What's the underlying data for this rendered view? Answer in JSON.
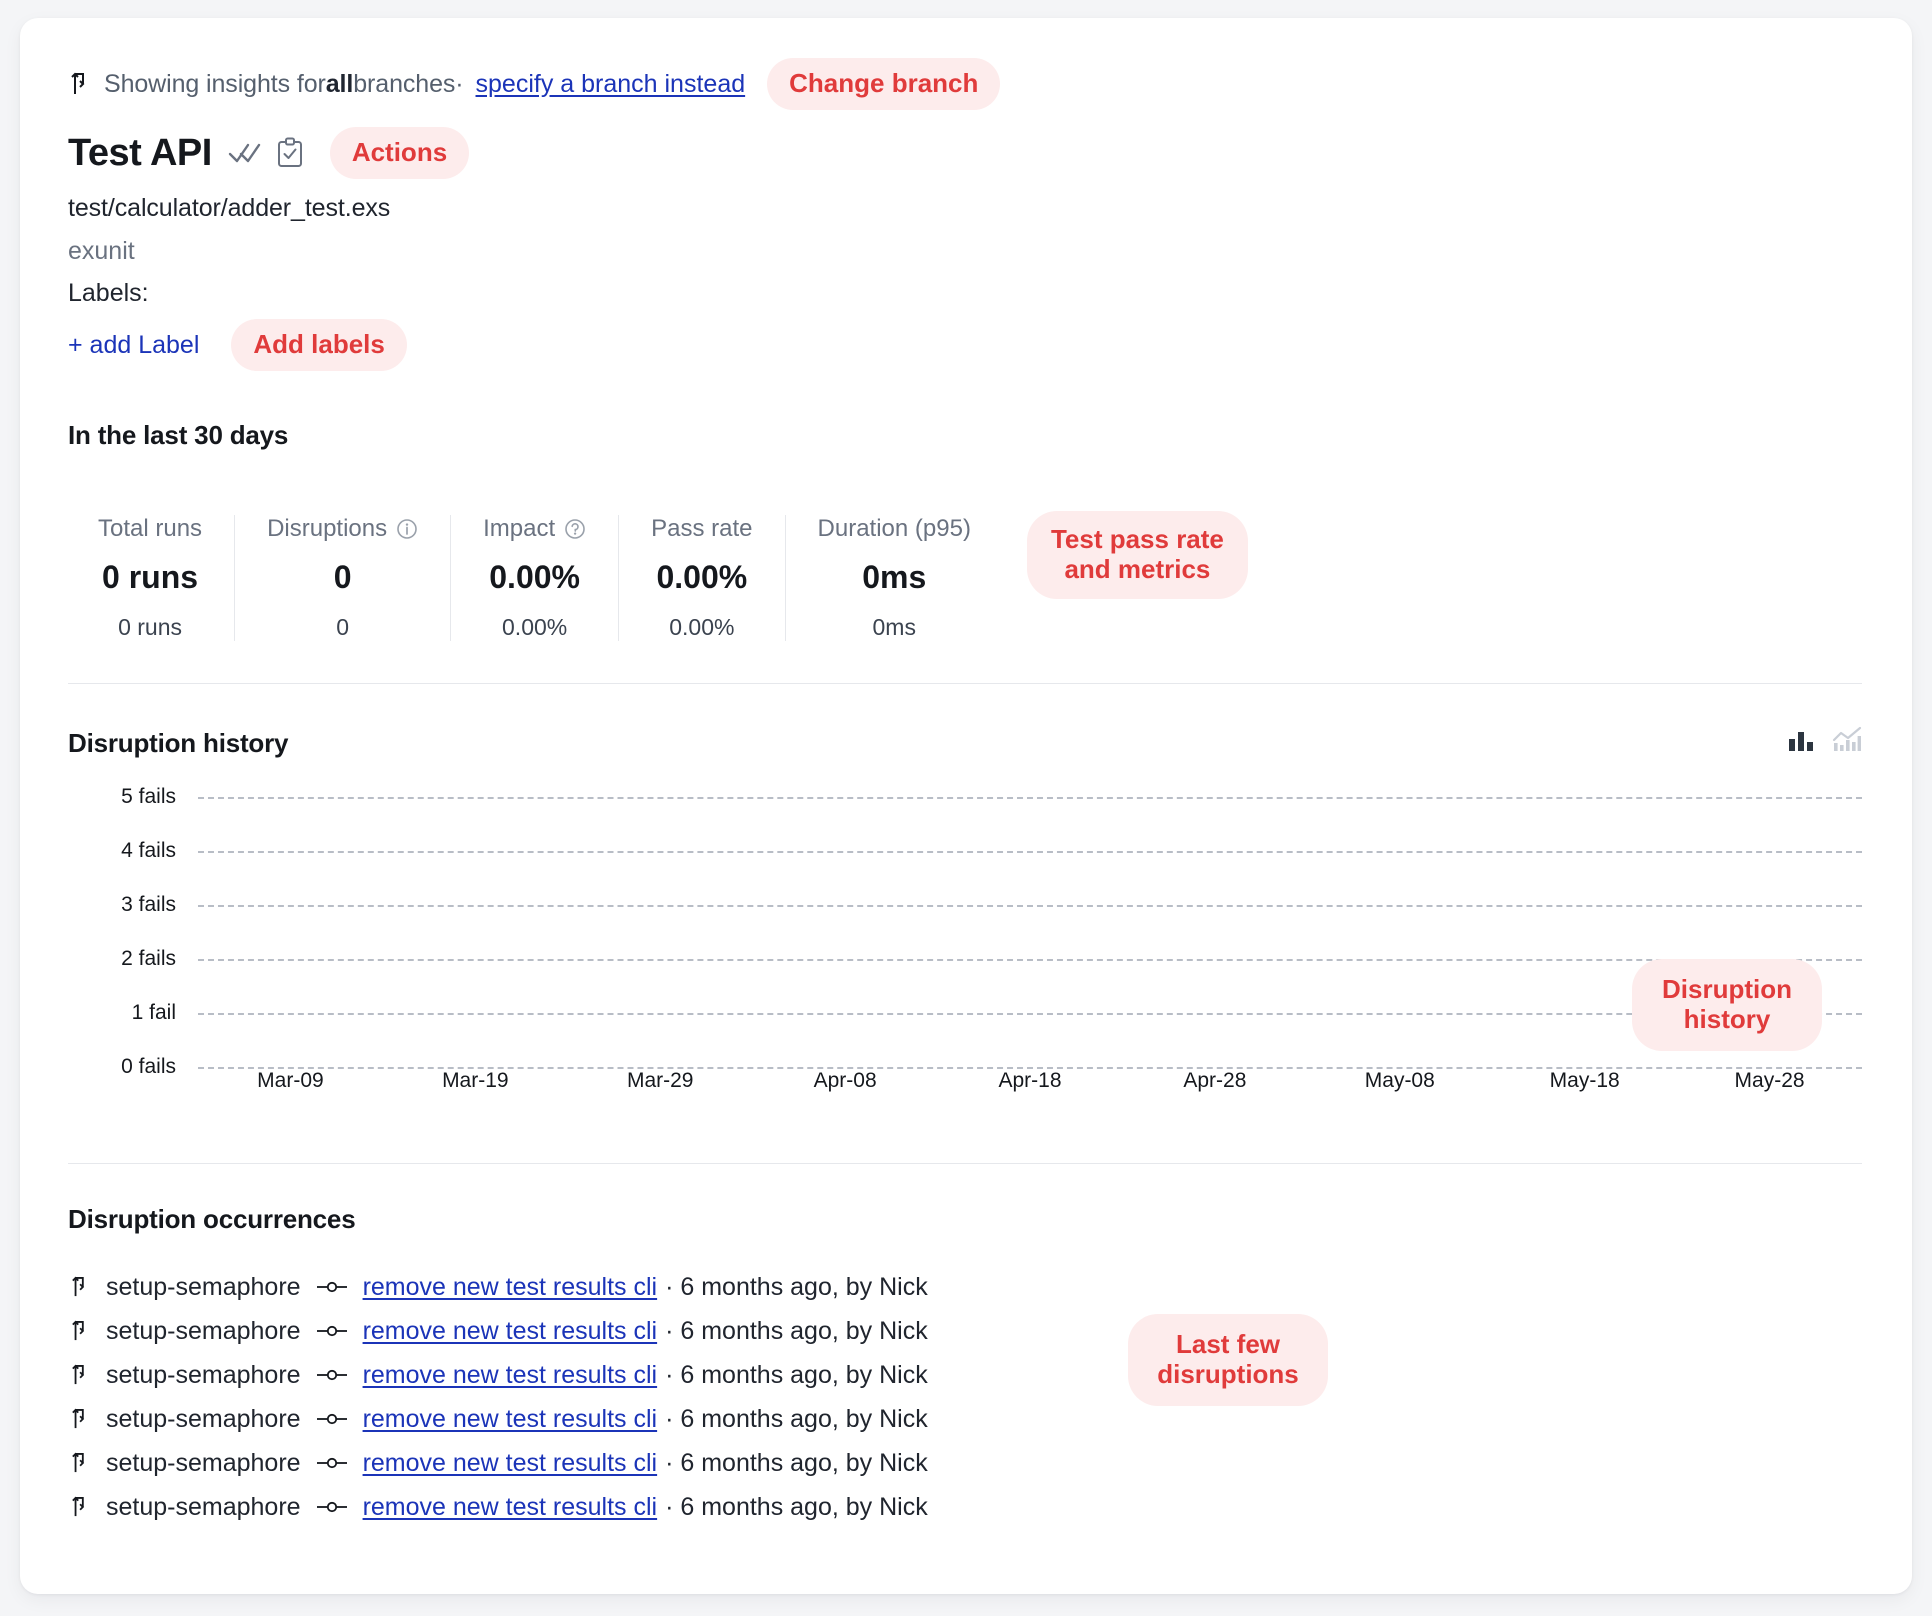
{
  "branch_notice": {
    "icon": "branch-icon",
    "prefix": "Showing insights for ",
    "bold": "all",
    "suffix": " branches·",
    "link": "specify a branch instead",
    "callout": "Change branch"
  },
  "test": {
    "title": "Test API",
    "icons": [
      "double-check-icon",
      "clipboard-check-icon"
    ],
    "actions_callout": "Actions",
    "path": "test/calculator/adder_test.exs",
    "framework": "exunit",
    "labels_heading": "Labels:",
    "add_label_link": "+ add Label",
    "add_labels_callout": "Add labels"
  },
  "metrics": {
    "heading": "In the last 30 days",
    "callout": "Test pass rate\nand metrics",
    "items": [
      {
        "label": "Total runs",
        "info": "",
        "value": "0 runs",
        "sub": "0 runs"
      },
      {
        "label": "Disruptions",
        "info": "ⓘ",
        "value": "0",
        "sub": "0"
      },
      {
        "label": "Impact",
        "info": "?",
        "value": "0.00%",
        "sub": "0.00%"
      },
      {
        "label": "Pass rate",
        "info": "",
        "value": "0.00%",
        "sub": "0.00%"
      },
      {
        "label": "Duration (p95)",
        "info": "",
        "value": "0ms",
        "sub": "0ms"
      }
    ]
  },
  "disruption_history": {
    "heading": "Disruption history",
    "callout": "Disruption\nhistory",
    "toggle": [
      {
        "icon": "bar-chart-icon",
        "active": true
      },
      {
        "icon": "line-chart-icon",
        "active": false
      }
    ]
  },
  "chart_data": {
    "type": "bar",
    "title": "Disruption history",
    "xlabel": "",
    "ylabel": "fails",
    "categories": [
      "Mar-09",
      "Mar-19",
      "Mar-29",
      "Apr-08",
      "Apr-18",
      "Apr-28",
      "May-08",
      "May-18",
      "May-28"
    ],
    "values": [
      0,
      0,
      0,
      0,
      0,
      0,
      0,
      0,
      0
    ],
    "ytick_labels": [
      "5 fails",
      "4 fails",
      "3 fails",
      "2 fails",
      "1 fail",
      "0 fails"
    ],
    "ytick_values": [
      5,
      4,
      3,
      2,
      1,
      0
    ],
    "ylim": [
      0,
      5
    ],
    "grid": true,
    "legend": "none"
  },
  "occurrences": {
    "heading": "Disruption occurrences",
    "callout": "Last few\ndisruptions",
    "rows": [
      {
        "branch": "setup-semaphore",
        "commit": "remove new test results cli",
        "when": "· 6 months ago, by Nick"
      },
      {
        "branch": "setup-semaphore",
        "commit": "remove new test results cli",
        "when": "· 6 months ago, by Nick"
      },
      {
        "branch": "setup-semaphore",
        "commit": "remove new test results cli",
        "when": "· 6 months ago, by Nick"
      },
      {
        "branch": "setup-semaphore",
        "commit": "remove new test results cli",
        "when": "· 6 months ago, by Nick"
      },
      {
        "branch": "setup-semaphore",
        "commit": "remove new test results cli",
        "when": "· 6 months ago, by Nick"
      },
      {
        "branch": "setup-semaphore",
        "commit": "remove new test results cli",
        "when": "· 6 months ago, by Nick"
      }
    ]
  },
  "colors": {
    "accent_red": "#e03b3b",
    "pill_bg": "#fdecec",
    "link_blue": "#1b34b8",
    "text_dark": "#15181d",
    "text_muted": "#6a7280",
    "page_bg": "#f4f5f7"
  }
}
